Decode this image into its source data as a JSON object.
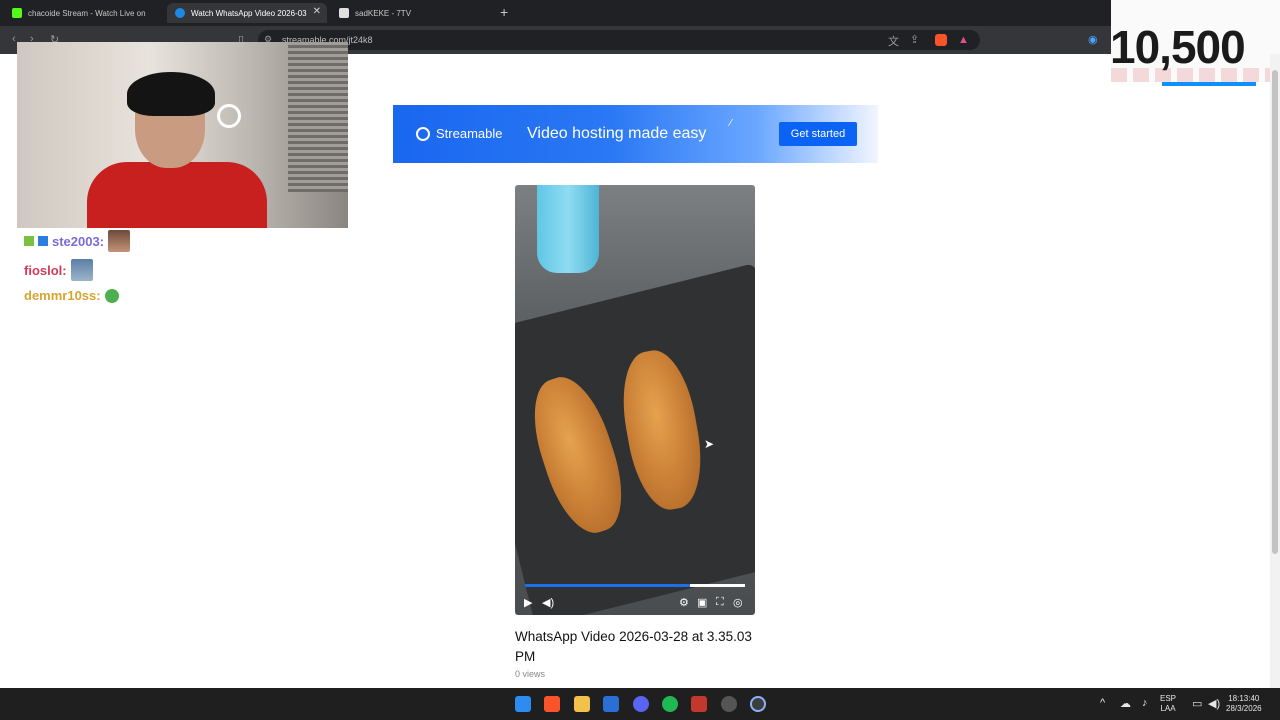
{
  "browser": {
    "tabs": [
      {
        "title": "chacoide Stream - Watch Live on",
        "fav_color": "#53fc18",
        "active": false
      },
      {
        "title": "Watch WhatsApp Video 2026-03",
        "fav_color": "#1e88e5",
        "active": true
      },
      {
        "title": "sadKEKE - 7TV",
        "fav_color": "#ffffff",
        "active": false
      }
    ],
    "new_tab": "+",
    "close": "✕",
    "url": "streamable.com/jt24k8"
  },
  "overlay": {
    "counter": "10,500"
  },
  "chat": [
    {
      "user": "ste2003:",
      "color": "#7b6bd6"
    },
    {
      "user": "fioslol:",
      "color": "#d23a5c"
    },
    {
      "user": "demmr10ss:",
      "color": "#d8a430"
    }
  ],
  "banner": {
    "brand": "Streamable",
    "tagline": "Video hosting made easy",
    "cta": "Get started"
  },
  "video": {
    "title": "WhatsApp Video 2026-03-28 at 3.35.03 PM",
    "views": "0 views",
    "progress": 0.75
  },
  "taskbar": {
    "lang_line1": "ESP",
    "lang_line2": "LAA",
    "time": "18:13:40",
    "date": "28/3/2026"
  },
  "colors": {
    "accent": "#0a63f5",
    "progress": "#1e6fe8"
  }
}
